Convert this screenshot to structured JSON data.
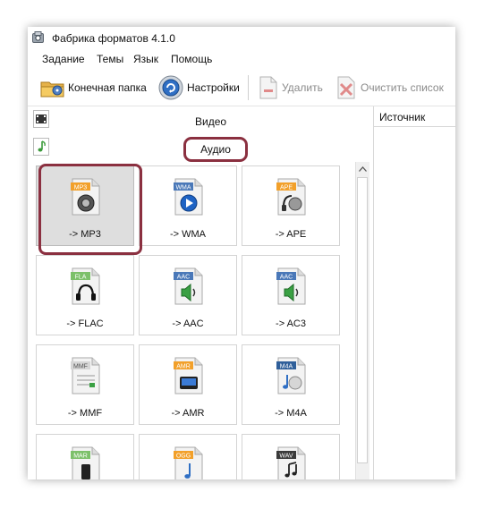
{
  "window": {
    "title": "Фабрика форматов 4.1.0",
    "icon": "app-icon"
  },
  "menu": [
    "Задание",
    "Темы",
    "Язык",
    "Помощь"
  ],
  "toolbar": {
    "output_folder": "Конечная папка",
    "settings": "Настройки",
    "delete": "Удалить",
    "clear_list": "Очистить список"
  },
  "categories": {
    "video": "Видео",
    "audio": "Аудио"
  },
  "formats": [
    {
      "tag": "MP3",
      "label": "-> MP3",
      "selected": true,
      "color": "#f2a02a",
      "icon": "speaker-icon"
    },
    {
      "tag": "WMA",
      "label": "-> WMA",
      "selected": false,
      "color": "#4a78b8",
      "icon": "play-icon"
    },
    {
      "tag": "APE",
      "label": "-> APE",
      "selected": false,
      "color": "#f2a02a",
      "icon": "headphones-disc-icon"
    },
    {
      "tag": "FLA",
      "label": "-> FLAC",
      "selected": false,
      "color": "#7cc06a",
      "icon": "headphones-icon"
    },
    {
      "tag": "AAC",
      "label": "-> AAC",
      "selected": false,
      "color": "#4a78b8",
      "icon": "green-speaker-icon"
    },
    {
      "tag": "AAC",
      "label": "-> AC3",
      "selected": false,
      "color": "#4a78b8",
      "icon": "green-speaker-icon"
    },
    {
      "tag": "MMF",
      "label": "-> MMF",
      "selected": false,
      "color": "#d6d6d6",
      "icon": "document-icon"
    },
    {
      "tag": "AMR",
      "label": "-> AMR",
      "selected": false,
      "color": "#f2a02a",
      "icon": "phone-icon"
    },
    {
      "tag": "M4A",
      "label": "-> M4A",
      "selected": false,
      "color": "#2f5f9a",
      "icon": "music-disc-icon"
    },
    {
      "tag": "MAR",
      "label": "",
      "selected": false,
      "color": "#7cc06a",
      "icon": "phone-icon"
    },
    {
      "tag": "OGG",
      "label": "",
      "selected": false,
      "color": "#f2a02a",
      "icon": "music-note-icon"
    },
    {
      "tag": "WAV",
      "label": "",
      "selected": false,
      "color": "#3a3a3a",
      "icon": "music-note-icon"
    }
  ],
  "source_panel": {
    "header": "Источник"
  }
}
